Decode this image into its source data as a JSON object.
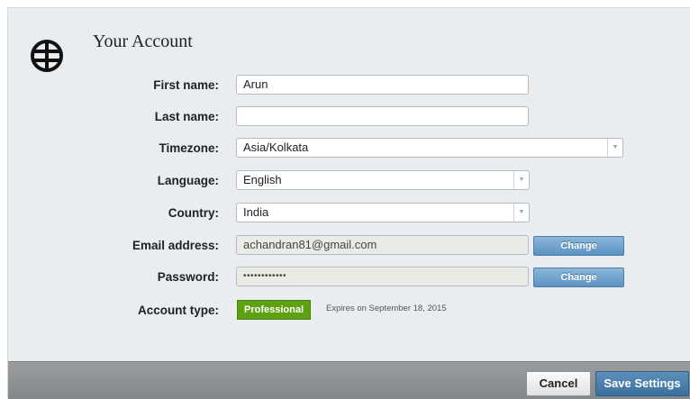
{
  "header": {
    "title": "Your Account",
    "logo_icon": "globe-icon"
  },
  "form": {
    "first_name": {
      "label": "First name:",
      "value": "Arun"
    },
    "last_name": {
      "label": "Last name:",
      "value": ""
    },
    "timezone": {
      "label": "Timezone:",
      "value": "Asia/Kolkata"
    },
    "language": {
      "label": "Language:",
      "value": "English"
    },
    "country": {
      "label": "Country:",
      "value": "India"
    },
    "email": {
      "label": "Email address:",
      "value": "achandran81@gmail.com",
      "button": "Change"
    },
    "password": {
      "label": "Password:",
      "value": "••••••••••••",
      "button": "Change"
    },
    "account_type": {
      "label": "Account type:",
      "badge": "Professional",
      "expires": "Expires on September 18, 2015"
    }
  },
  "footer": {
    "cancel_label": "Cancel",
    "save_label": "Save Settings"
  },
  "colors": {
    "badge_green": "#5ea213",
    "change_blue": "#6a9fcb",
    "save_blue": "#3b6f9d",
    "footer_gray": "#8f9295"
  }
}
